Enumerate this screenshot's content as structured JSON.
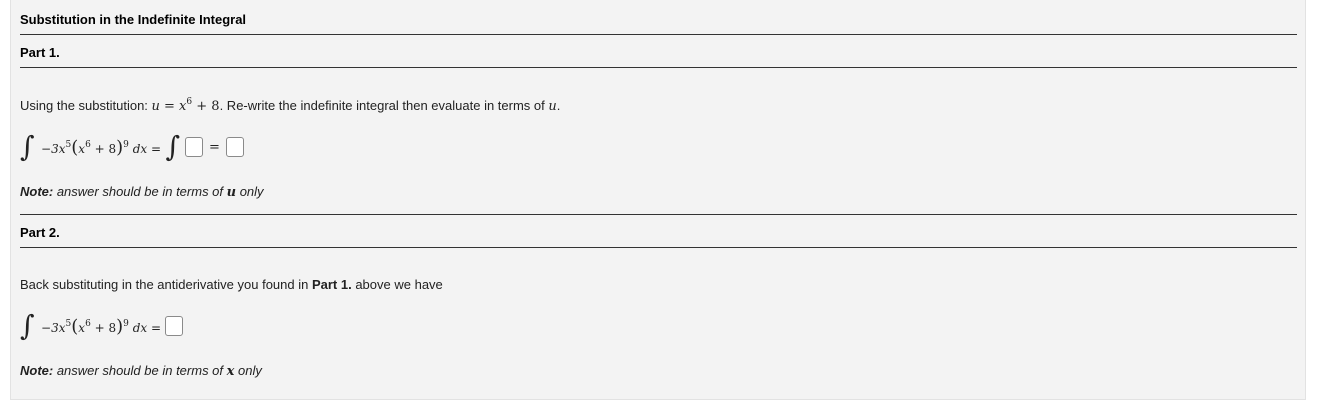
{
  "title": "Substitution in the Indefinite Integral",
  "part1": {
    "heading": "Part 1.",
    "instruction_prefix": "Using the substitution: ",
    "substitution": "u = x",
    "substitution_exp": "6",
    "substitution_rest": " + 8",
    "instruction_suffix": ". Re-write the indefinite integral then evaluate in terms of ",
    "instruction_var": "u",
    "instruction_end": ".",
    "integrand_coef": "−3x",
    "integrand_coef_exp": "5",
    "integrand_inner": "x",
    "integrand_inner_exp": "6",
    "integrand_inner_rest": " + 8",
    "integrand_outer_exp": "9",
    "integrand_dx": " dx =",
    "eq_sign": "=",
    "note_label": "Note:",
    "note_text": " answer should be in terms of ",
    "note_var": "u",
    "note_end": " only"
  },
  "part2": {
    "heading": "Part 2.",
    "text_prefix": "Back substituting in the antiderivative you found in ",
    "text_bold": "Part 1.",
    "text_suffix": " above we have",
    "integrand_coef": "−3x",
    "integrand_coef_exp": "5",
    "integrand_inner": "x",
    "integrand_inner_exp": "6",
    "integrand_inner_rest": " + 8",
    "integrand_outer_exp": "9",
    "integrand_dx": " dx =",
    "note_label": "Note:",
    "note_text": " answer should be in terms of ",
    "note_var": "x",
    "note_end": " only"
  }
}
